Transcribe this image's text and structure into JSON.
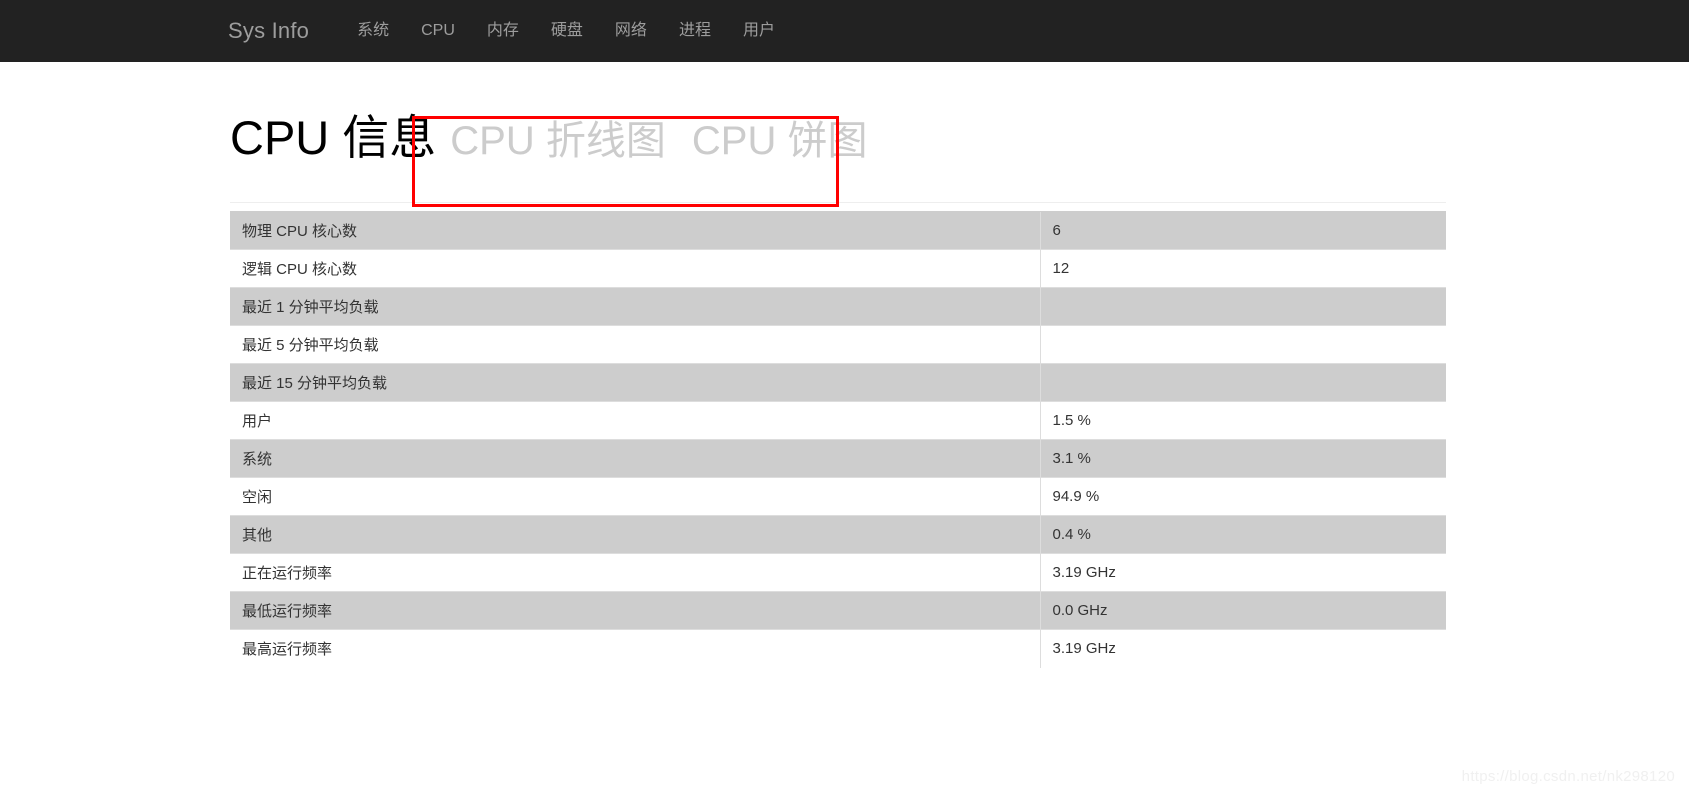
{
  "navbar": {
    "brand": "Sys Info",
    "items": [
      {
        "label": "系统"
      },
      {
        "label": "CPU"
      },
      {
        "label": "内存"
      },
      {
        "label": "硬盘"
      },
      {
        "label": "网络"
      },
      {
        "label": "进程"
      },
      {
        "label": "用户"
      }
    ]
  },
  "page": {
    "title": "CPU 信息",
    "links": [
      {
        "label": "CPU 折线图"
      },
      {
        "label": "CPU 饼图"
      }
    ],
    "annotation_color": "#ff0000"
  },
  "table": {
    "rows": [
      {
        "key": "物理 CPU 核心数",
        "value": "6"
      },
      {
        "key": "逻辑 CPU 核心数",
        "value": "12"
      },
      {
        "key": "最近 1 分钟平均负载",
        "value": ""
      },
      {
        "key": "最近 5 分钟平均负载",
        "value": ""
      },
      {
        "key": "最近 15 分钟平均负载",
        "value": ""
      },
      {
        "key": "用户",
        "value": "1.5 %"
      },
      {
        "key": "系统",
        "value": "3.1 %"
      },
      {
        "key": "空闲",
        "value": "94.9 %"
      },
      {
        "key": "其他",
        "value": "0.4 %"
      },
      {
        "key": "正在运行频率",
        "value": "3.19 GHz"
      },
      {
        "key": "最低运行频率",
        "value": "0.0 GHz"
      },
      {
        "key": "最高运行频率",
        "value": "3.19 GHz"
      }
    ]
  },
  "watermark": {
    "text": "https://blog.csdn.net/nk298120"
  }
}
